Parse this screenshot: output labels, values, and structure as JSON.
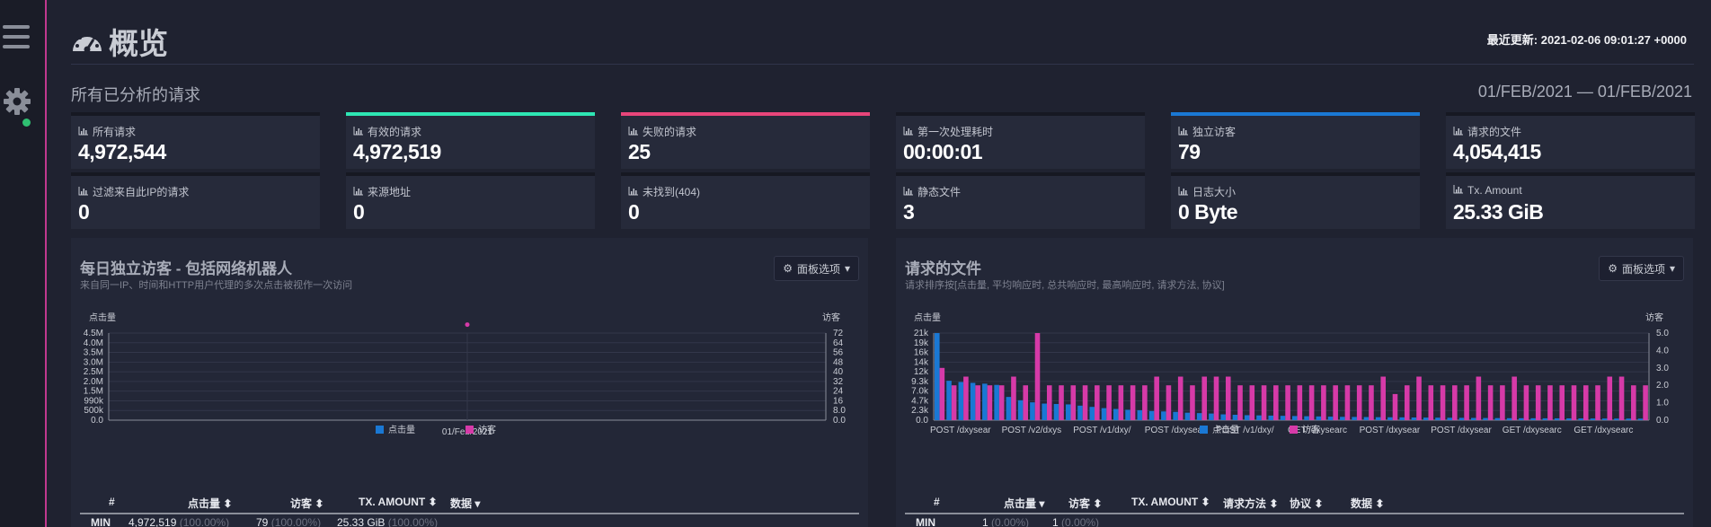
{
  "page": {
    "title": "概览",
    "last_updated_label": "最近更新: 2021-02-06 09:01:27 +0000",
    "subtitle": "所有已分析的请求",
    "date_range": "01/FEB/2021 — 01/FEB/2021"
  },
  "colors": {
    "valid": "#2ee6b4",
    "failed": "#e8457a",
    "visitors": "#1a78d4",
    "hits_series": "#1a78d4",
    "visitors_series": "#d63aa8"
  },
  "cards": [
    {
      "label": "所有请求",
      "value": "4,972,544",
      "accent": ""
    },
    {
      "label": "有效的请求",
      "value": "4,972,519",
      "accent": "#2ee6b4"
    },
    {
      "label": "失败的请求",
      "value": "25",
      "accent": "#e8457a"
    },
    {
      "label": "第一次处理耗时",
      "value": "00:00:01",
      "accent": ""
    },
    {
      "label": "独立访客",
      "value": "79",
      "accent": "#1a78d4"
    },
    {
      "label": "请求的文件",
      "value": "4,054,415",
      "accent": ""
    },
    {
      "label": "过滤来自此IP的请求",
      "value": "0",
      "accent": ""
    },
    {
      "label": "来源地址",
      "value": "0",
      "accent": ""
    },
    {
      "label": "未找到(404)",
      "value": "0",
      "accent": ""
    },
    {
      "label": "静态文件",
      "value": "3",
      "accent": ""
    },
    {
      "label": "日志大小",
      "value": "0 Byte",
      "accent": ""
    },
    {
      "label": "Tx. Amount",
      "value": "25.33 GiB",
      "accent": ""
    }
  ],
  "panel_visitors": {
    "title": "每日独立访客 - 包括网络机器人",
    "subtitle": "来自同一IP、时间和HTTP用户代理的多次点击被视作一次访问",
    "options_label": "面板选项",
    "table": {
      "headers": [
        "#",
        "点击量",
        "访客",
        "TX. AMOUNT",
        "数据"
      ],
      "row": {
        "label": "MIN",
        "hits": "4,972,519",
        "hits_pct": "(100.00%)",
        "visitors": "79",
        "visitors_pct": "(100.00%)",
        "tx": "25.33 GiB",
        "tx_pct": "(100.00%)"
      }
    }
  },
  "panel_files": {
    "title": "请求的文件",
    "subtitle": "请求排序按[点击量, 平均响应时, 总共响应时, 最高响应时, 请求方法, 协议]",
    "options_label": "面板选项",
    "table": {
      "headers": [
        "#",
        "点击量",
        "访客",
        "TX. AMOUNT",
        "请求方法",
        "协议",
        "数据"
      ],
      "row": {
        "label": "MIN",
        "hits": "1",
        "hits_pct": "(0.00%)",
        "visitors": "1",
        "visitors_pct": "(0.00%)"
      }
    }
  },
  "chart_data": [
    {
      "type": "line",
      "title": "",
      "ylabel": "点击量",
      "y2label": "访客",
      "x": [
        "01/Feb/2021"
      ],
      "y_ticks": [
        "0.0",
        "500k",
        "990k",
        "1.5M",
        "2.0M",
        "2.5M",
        "3.0M",
        "3.5M",
        "4.0M",
        "4.5M"
      ],
      "y2_ticks": [
        "0.0",
        "8.0",
        "16",
        "24",
        "32",
        "40",
        "48",
        "56",
        "64",
        "72"
      ],
      "series": [
        {
          "name": "点击量",
          "values": [
            4972519
          ]
        },
        {
          "name": "访客",
          "values": [
            79
          ]
        }
      ],
      "legend": "bottom-center",
      "grid": true
    },
    {
      "type": "bar",
      "title": "",
      "ylabel": "点击量",
      "y2label": "访客",
      "y_ticks": [
        "0.0",
        "2.3k",
        "4.7k",
        "7.0k",
        "9.3k",
        "12k",
        "14k",
        "16k",
        "19k",
        "21k"
      ],
      "y2_ticks": [
        "0.0",
        "1.0",
        "2.0",
        "3.0",
        "4.0",
        "5.0"
      ],
      "x_labels": [
        "POST /dxysear",
        "POST /v2/dxys",
        "POST /v1/dxy/",
        "POST /dxysear",
        "POST /v1/dxy/",
        "GET /dxysearc",
        "POST /dxysear",
        "POST /dxysear",
        "GET /dxysearc",
        "GET /dxysearc"
      ],
      "series": [
        {
          "name": "点击量",
          "values": [
            21000,
            9500,
            9200,
            9000,
            8800,
            8500,
            5600,
            4800,
            4300,
            4000,
            3900,
            3800,
            3500,
            3200,
            2900,
            2700,
            2500,
            2400,
            2200,
            2100,
            2000,
            1800,
            1700,
            1600,
            1400,
            1300,
            1200,
            1150,
            1100,
            1050,
            1000,
            950,
            900,
            850,
            800,
            780,
            750,
            720,
            700,
            680,
            650,
            620,
            600,
            580,
            560,
            540,
            520,
            500,
            480,
            470,
            460,
            450,
            440,
            430,
            420,
            410,
            400,
            390,
            380,
            370
          ]
        },
        {
          "name": "访客",
          "values": [
            3,
            2,
            2.5,
            2,
            2,
            2,
            2.5,
            2,
            5,
            2,
            2,
            2,
            2,
            2,
            2,
            2,
            2,
            2,
            2.5,
            2,
            2.5,
            2,
            2.5,
            2.5,
            2.5,
            2,
            2,
            2,
            2,
            2,
            2,
            2,
            2,
            2,
            2,
            2,
            2,
            2.5,
            1.5,
            2,
            2.5,
            2,
            2,
            2,
            2,
            2.5,
            2,
            2,
            2.5,
            2,
            2,
            2,
            2,
            2,
            2,
            2,
            2.5,
            2.5,
            2,
            2
          ]
        }
      ],
      "legend": "bottom-center",
      "grid": true
    }
  ]
}
